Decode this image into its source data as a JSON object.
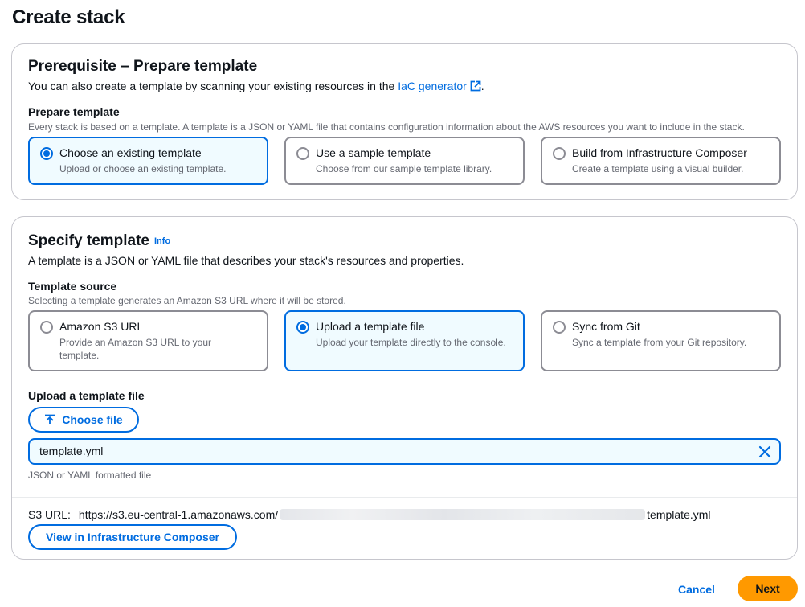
{
  "page": {
    "title": "Create stack"
  },
  "prerequisite": {
    "heading": "Prerequisite – Prepare template",
    "description_prefix": "You can also create a template by scanning your existing resources in the ",
    "description_link": "IaC generator",
    "description_suffix": ".",
    "field_label": "Prepare template",
    "field_description": "Every stack is based on a template. A template is a JSON or YAML file that contains configuration information about the AWS resources you want to include in the stack.",
    "options": [
      {
        "title": "Choose an existing template",
        "description": "Upload or choose an existing template.",
        "selected": true
      },
      {
        "title": "Use a sample template",
        "description": "Choose from our sample template library.",
        "selected": false
      },
      {
        "title": "Build from Infrastructure Composer",
        "description": "Create a template using a visual builder.",
        "selected": false
      }
    ]
  },
  "specify": {
    "heading": "Specify template",
    "info_link": "Info",
    "description": "A template is a JSON or YAML file that describes your stack's resources and properties.",
    "source_label": "Template source",
    "source_description": "Selecting a template generates an Amazon S3 URL where it will be stored.",
    "options": [
      {
        "title": "Amazon S3 URL",
        "description": "Provide an Amazon S3 URL to your template.",
        "selected": false
      },
      {
        "title": "Upload a template file",
        "description": "Upload your template directly to the console.",
        "selected": true
      },
      {
        "title": "Sync from Git",
        "description": "Sync a template from your Git repository.",
        "selected": false
      }
    ],
    "upload_label": "Upload a template file",
    "choose_file_label": "Choose file",
    "file_name": "template.yml",
    "file_hint": "JSON or YAML formatted file",
    "s3_label": "S3 URL:",
    "s3_url_prefix": "https://s3.eu-central-1.amazonaws.com/",
    "s3_url_suffix": "template.yml",
    "view_composer_label": "View in Infrastructure Composer"
  },
  "footer": {
    "cancel_label": "Cancel",
    "next_label": "Next"
  },
  "colors": {
    "accent": "#006ce0",
    "primary_button": "#ff9900",
    "selected_bg": "#f0fbff"
  },
  "icons": {
    "external_link": "external-link-icon",
    "upload": "upload-icon",
    "clear": "close-icon"
  }
}
